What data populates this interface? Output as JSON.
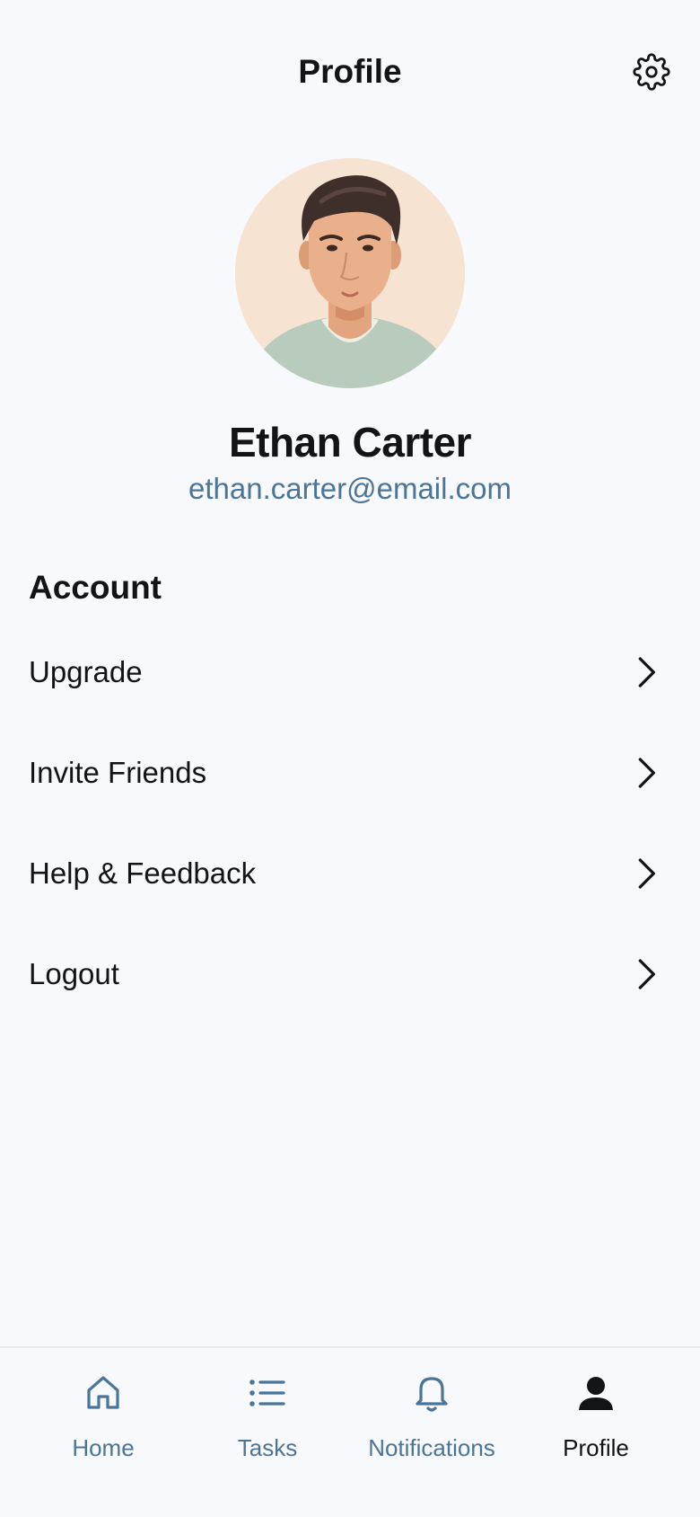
{
  "header": {
    "title": "Profile",
    "settings_icon": "gear-icon"
  },
  "profile": {
    "name": "Ethan Carter",
    "email": "ethan.carter@email.com"
  },
  "account": {
    "section_title": "Account",
    "items": [
      {
        "label": "Upgrade",
        "icon": "chevron-right-icon"
      },
      {
        "label": "Invite Friends",
        "icon": "chevron-right-icon"
      },
      {
        "label": "Help & Feedback",
        "icon": "chevron-right-icon"
      },
      {
        "label": "Logout",
        "icon": "chevron-right-icon"
      }
    ]
  },
  "bottom_nav": {
    "items": [
      {
        "label": "Home",
        "icon": "home-icon",
        "active": false
      },
      {
        "label": "Tasks",
        "icon": "list-icon",
        "active": false
      },
      {
        "label": "Notifications",
        "icon": "bell-icon",
        "active": false
      },
      {
        "label": "Profile",
        "icon": "person-icon",
        "active": true
      }
    ]
  },
  "colors": {
    "background": "#f7f9fc",
    "text_primary": "#121417",
    "accent": "#4a7599",
    "divider": "#e6e9ee",
    "avatar_bg": "#f7e3d2"
  }
}
